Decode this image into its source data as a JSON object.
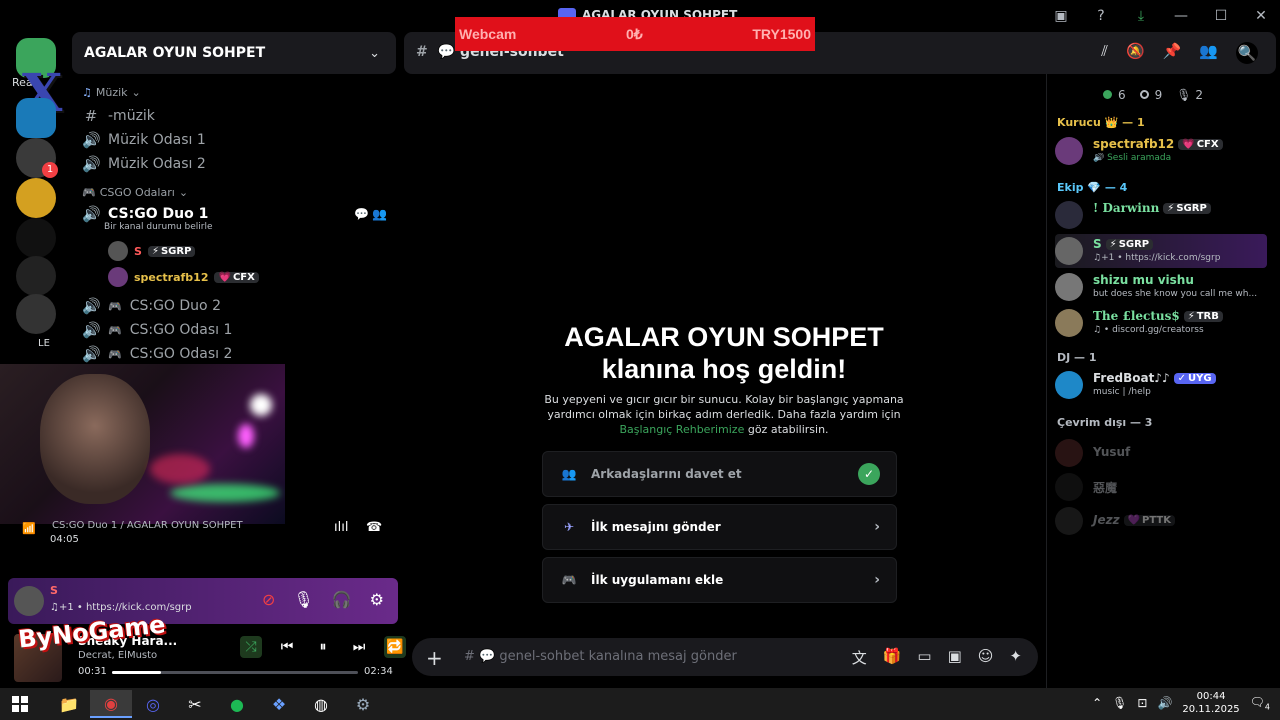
{
  "window": {
    "title": "AGALAR OYUN SOHPET",
    "buttons": [
      "inbox",
      "help",
      "download",
      "minimize",
      "maximize",
      "close"
    ]
  },
  "overlay": {
    "left": "Webcam",
    "middle": "0₺",
    "right": "TRY1500"
  },
  "rail": {
    "letter": "X",
    "label": "Rea",
    "badge": "1",
    "dm_label": "LE"
  },
  "server": {
    "name": "AGALAR OYUN SOHPET"
  },
  "channels": {
    "music_category": "Müzik",
    "music_text": "-müzik",
    "music_room_1": "Müzik Odası 1",
    "music_room_2": "Müzik Odası 2",
    "csgo_category": "CSGO Odaları",
    "csgo_duo_1": "CS:GO Duo 1",
    "csgo_duo_1_status": "Bir kanal durumu belirle",
    "voice_users": [
      {
        "name": "S",
        "tag": "SGRP",
        "color": "#ff5a5a"
      },
      {
        "name": "spectrafb12",
        "tag": "CFX",
        "color": "#e6c04a"
      }
    ],
    "csgo_duo_2": "CS:GO Duo 2",
    "csgo_room_1": "CS:GO Odası 1",
    "csgo_room_2": "CS:GO Odası 2"
  },
  "voice_connection": {
    "line": "CS:GO Duo 1 / AGALAR OYUN SOHPET",
    "time": "04:05"
  },
  "user_panel": {
    "name": "S",
    "status": "♫+1 •  https://kick.com/sgrp"
  },
  "player": {
    "track": "Sneaky Hara...",
    "artist": "Decrat, ElMusto",
    "elapsed": "00:31",
    "duration": "02:34",
    "progress": 0.2
  },
  "watermark": "ByNoGame",
  "channel_header": {
    "name": "genel-sohbet"
  },
  "welcome": {
    "title_1": "AGALAR OYUN SOHPET",
    "title_2": "klanına hoş geldin!",
    "desc_1": "Bu yepyeni ve gıcır gıcır bir sunucu. Kolay bir başlangıç yapmana yardımcı olmak için birkaç adım derledik. Daha fazla yardım için",
    "desc_link": "Başlangıç Rehberimize",
    "desc_2": "göz atabilirsin.",
    "cards": [
      {
        "label": "Arkadaşlarını davet et",
        "done": true
      },
      {
        "label": "İlk mesajını gönder",
        "done": false
      },
      {
        "label": "İlk uygulamanı ekle",
        "done": false
      }
    ]
  },
  "composer": {
    "placeholder": "# 💬 genel-sohbet kanalına mesaj gönder"
  },
  "member_counts": {
    "online": "6",
    "idle": "9",
    "voice": "2"
  },
  "members": {
    "role_founder": "Kurucu 👑 — 1",
    "founder": {
      "name": "spectrafb12",
      "tag": "CFX",
      "sub": "🔊 Sesli aramada"
    },
    "role_team": "Ekip 💎 — 4",
    "team": [
      {
        "name": "! Darwinn",
        "tag": "SGRP",
        "sub": ""
      },
      {
        "name": "S",
        "tag": "SGRP",
        "sub": "♫+1 •  https://kick.com/sgrp"
      },
      {
        "name": "shizu mu vishu",
        "tag": "",
        "sub": "but does she know you call me wh..."
      },
      {
        "name": "The £lectus$",
        "tag": "TRB",
        "sub": "♫ •  discord.gg/creatorss"
      }
    ],
    "role_dj": "DJ — 1",
    "dj": {
      "name": "FredBoat♪♪",
      "tag": "UYG",
      "sub": "music | /help"
    },
    "role_offline": "Çevrim dışı — 3",
    "offline": [
      {
        "name": "Yusuf",
        "tag": ""
      },
      {
        "name": "惡魔",
        "tag": ""
      },
      {
        "name": "Jezz",
        "tag": "PTTK"
      }
    ]
  },
  "clock": {
    "time": "00:44",
    "date": "20.11.2025"
  },
  "notifications": "4"
}
